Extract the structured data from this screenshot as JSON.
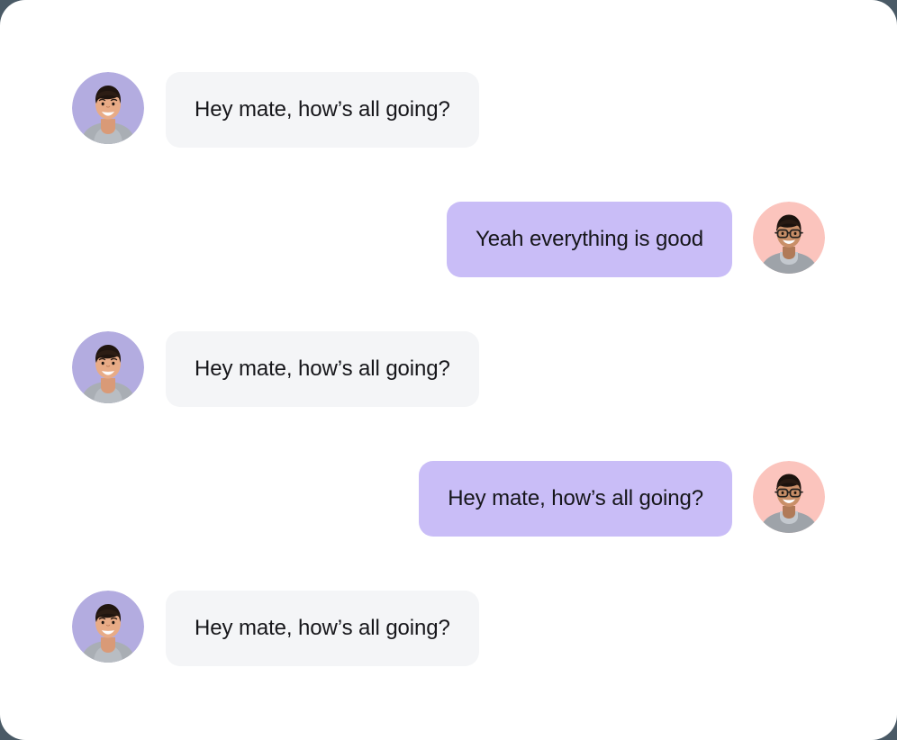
{
  "card": {
    "background": "#ffffff",
    "corner_radius_px": 28,
    "page_background": "#4a5a66"
  },
  "theme": {
    "incoming_bubble_color": "#f4f5f7",
    "outgoing_bubble_color": "#c9bdf7",
    "text_color": "#16161a",
    "incoming_avatar_background": "#b3ace0",
    "outgoing_avatar_background": "#fbc4bd"
  },
  "conversation": {
    "messages": [
      {
        "direction": "incoming",
        "text": "Hey mate, how’s all going?",
        "avatar": "avatar-man-lavender"
      },
      {
        "direction": "outgoing",
        "text": "Yeah everything is good",
        "avatar": "avatar-man-glasses-pink"
      },
      {
        "direction": "incoming",
        "text": "Hey mate, how’s all going?",
        "avatar": "avatar-man-lavender"
      },
      {
        "direction": "outgoing",
        "text": "Hey mate, how’s all going?",
        "avatar": "avatar-man-glasses-pink"
      },
      {
        "direction": "incoming",
        "text": "Hey mate, how’s all going?",
        "avatar": "avatar-man-lavender"
      }
    ]
  }
}
